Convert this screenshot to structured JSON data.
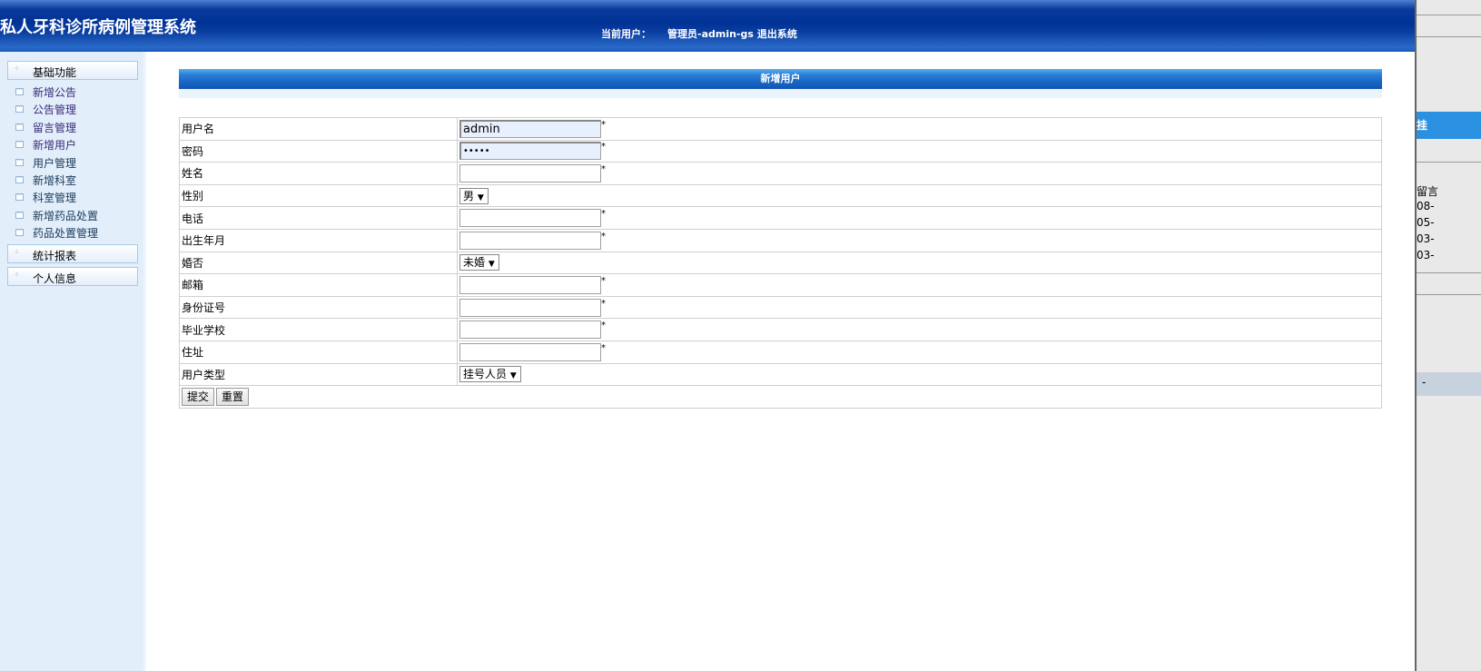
{
  "header": {
    "title": "私人牙科诊所病例管理系统",
    "current_user_label": "当前用户：",
    "current_user": "管理员-admin-gs",
    "logout": "退出系统"
  },
  "sidebar": {
    "groups": [
      {
        "label": "基础功能",
        "icon": "expand-icon"
      },
      {
        "label": "统计报表",
        "icon": "expand-icon"
      },
      {
        "label": "个人信息",
        "icon": "expand-icon"
      }
    ],
    "items": [
      {
        "label": "新增公告"
      },
      {
        "label": "公告管理"
      },
      {
        "label": "留言管理"
      },
      {
        "label": "新增用户"
      },
      {
        "label": "用户管理"
      },
      {
        "label": "新增科室"
      },
      {
        "label": "科室管理"
      },
      {
        "label": "新增药品处置"
      },
      {
        "label": "药品处置管理"
      }
    ]
  },
  "form": {
    "title": "新增用户",
    "required_mark": "*",
    "fields": {
      "username": {
        "label": "用户名",
        "value": "admin"
      },
      "password": {
        "label": "密码",
        "value": "•••••"
      },
      "name": {
        "label": "姓名",
        "value": ""
      },
      "gender": {
        "label": "性别",
        "value": "男"
      },
      "phone": {
        "label": "电话",
        "value": ""
      },
      "birth": {
        "label": "出生年月",
        "value": ""
      },
      "married": {
        "label": "婚否",
        "value": "未婚"
      },
      "email": {
        "label": "邮箱",
        "value": ""
      },
      "idcard": {
        "label": "身份证号",
        "value": ""
      },
      "school": {
        "label": "毕业学校",
        "value": ""
      },
      "address": {
        "label": "住址",
        "value": ""
      },
      "usertype": {
        "label": "用户类型",
        "value": "挂号人员"
      }
    },
    "submit": "提交",
    "reset": "重置",
    "dropdown_arrow": "▼"
  },
  "background_window": {
    "tab": "挂",
    "col": "留言",
    "rows": [
      "08-",
      "05-",
      "03-",
      "03-"
    ],
    "dash": "-"
  }
}
